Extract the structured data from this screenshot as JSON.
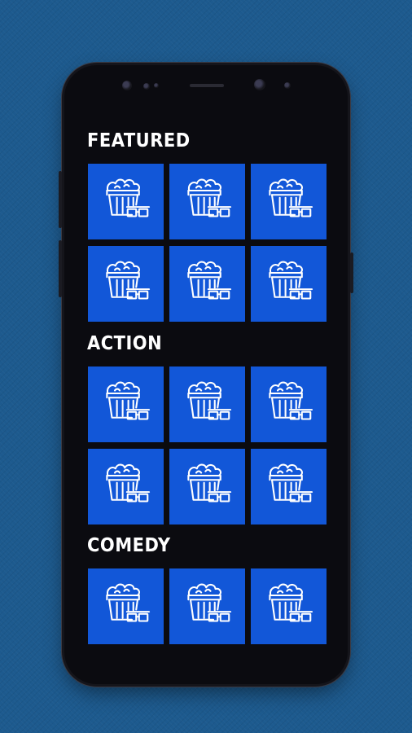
{
  "theme": {
    "background": "#1d5a8e",
    "phone_body": "#0b0b10",
    "tile_color": "#1257d8",
    "icon_color": "#ffffff",
    "title_color": "#ffffff"
  },
  "sections": [
    {
      "title": "Featured",
      "display_title": "FEATURED",
      "items": [
        {
          "icon": "popcorn-3d-glasses-icon"
        },
        {
          "icon": "popcorn-3d-glasses-icon"
        },
        {
          "icon": "popcorn-3d-glasses-icon"
        },
        {
          "icon": "popcorn-3d-glasses-icon"
        },
        {
          "icon": "popcorn-3d-glasses-icon"
        },
        {
          "icon": "popcorn-3d-glasses-icon"
        }
      ]
    },
    {
      "title": "Action",
      "display_title": "ACTION",
      "items": [
        {
          "icon": "popcorn-3d-glasses-icon"
        },
        {
          "icon": "popcorn-3d-glasses-icon"
        },
        {
          "icon": "popcorn-3d-glasses-icon"
        },
        {
          "icon": "popcorn-3d-glasses-icon"
        },
        {
          "icon": "popcorn-3d-glasses-icon"
        },
        {
          "icon": "popcorn-3d-glasses-icon"
        }
      ]
    },
    {
      "title": "Comedy",
      "display_title": "COMEDY",
      "items": [
        {
          "icon": "popcorn-3d-glasses-icon"
        },
        {
          "icon": "popcorn-3d-glasses-icon"
        },
        {
          "icon": "popcorn-3d-glasses-icon"
        }
      ]
    }
  ]
}
